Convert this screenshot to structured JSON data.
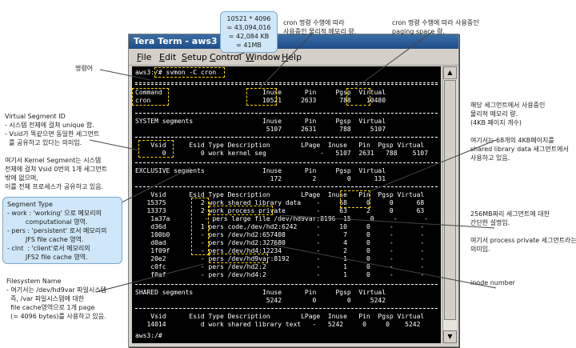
{
  "window": {
    "title": "Tera Term - aws3",
    "menu": [
      "File",
      "Edit",
      "Setup",
      "Control",
      "Window",
      "Help"
    ]
  },
  "terminal": {
    "prompt_line": "aws3:/# svmon -C cron",
    "command_header": "Command                          Inuse      Pin     Pgsp  Virtual",
    "command_row": "cron                             10521     2633      788    10480",
    "system_header": "SYSTEM segments                  Inuse      Pin     Pgsp  Virtual",
    "system_totals": "                                  5107     2631      788     5107",
    "system_col_header": "    Vsid      Esid Type Description        LPage  Inuse   Pin  Pgsp Virtual",
    "system_rows": [
      "       0         0 work kernel seg              -   5107  2631   788    5107"
    ],
    "exclusive_header": "EXCLUSIVE segments               Inuse      Pin     Pgsp  Virtual",
    "exclusive_totals": "                                   172        2        0      131",
    "exclusive_col_header": "    Vsid      Esid Type Description        LPage  Inuse   Pin  Pgsp Virtual",
    "exclusive_rows": [
      "   15375         2 work shared library data    -     68     0     0      68",
      "   13373         2 work process private        -     63     2     0      63",
      "    1a37a         - pers large file /dev/hd9var:8196  15     0     -       -",
      "    d36d         1 pers code,/dev/hd2:6242     -     10     0     -       -",
      "    100b0        - pers /dev/hd2:657408        -      7     0     -       -",
      "    d0ad         - pers /dev/hd2:327680        -      4     0     -       -",
      "    1f09f        - pers /dev/hd4:12234         -      2     0     -       -",
      "    20e2         - pers /dev/hd9var:8192       -      1     0     -       -",
      "    c0fc         - pers /dev/hd2:2             -      1     0     -       -",
      "    f0af         - pers /dev/hd4:2             -      1     0     -       -"
    ],
    "shared_header": "SHARED segments                  Inuse      Pin     Pgsp  Virtual",
    "shared_totals": "                                  5242        0        0     5242",
    "shared_col_header": "    Vsid      Esid Type Description        LPage  Inuse   Pin  Pgsp Virtual",
    "shared_rows": [
      "   14014         d work shared library text   -   5242     0     0    5242"
    ],
    "final_prompt": "aws3:/# "
  },
  "annotations": {
    "calc_box": "10521 * 4096\n= 43,094,016\n= 42,084 KB\n= 41MB",
    "cron_inuse": "cron 명령 수행에 따라\n사용중인 물리적 메모리 량.",
    "cron_pgsp": "cron 명령 수행에 따라 사용중인\npaging space 량.",
    "command_name": "명령어",
    "vsid": "Virtual Segment ID\n- 시스템 전체에 걸쳐 unique 함.\n- Vsid가 똑같으면 동일한 세그먼트\n  를 공유하고 있다는 의미임.\n\n여기서 Kernel Segment는 시스템\n전체에 걸쳐 Vsid 0번의 1개 세그먼트\n밖에 없으며,\n이를 전체 프로세스가 공유하고 있음.",
    "segment_type": "Segment Type\n- work : 'working' 으로 메모리의\n         computational 영역.\n- pers : 'persistent' 로서 메모리의\n         JFS file cache 영역.\n- clnt  : 'client'로서 메모리의\n         JFS2 file cache 영역.",
    "filesystem": "Filesystem Name\n- 여기서는 /dev/hd9var 파일시스템\n  즉, /var 파일시스템에 대한\n  file cache영역으로 1개 page\n  (= 4096 bytes)를 사용하고 있음.",
    "segment_inuse": "해당 세그먼트에서 사용중인\n물리적 메모리 량.\n(4KB 페이지 개수)\n\n여기서는 68개의 4KB페이지를\nshared library data 세그먼트에서\n사용하고 있음.",
    "segment_desc": "256MB짜리 세그먼트에 대한\n간단한 설명임.\n\n여기서 process private 세그먼트라는\n의미임.",
    "inode": "inode number"
  }
}
